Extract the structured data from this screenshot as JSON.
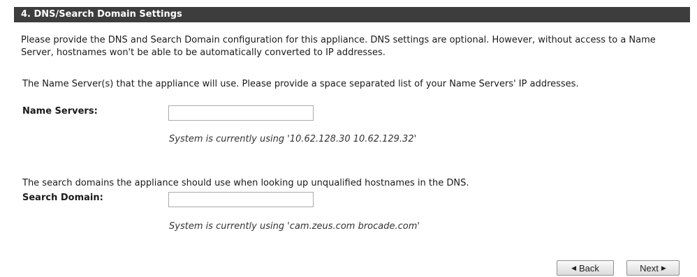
{
  "section": {
    "title": "4. DNS/Search Domain Settings",
    "intro": "Please provide the DNS and Search Domain configuration for this appliance. DNS settings are optional. However, without access to a Name Server, hostnames won't be able to be automatically converted to IP addresses."
  },
  "name_servers": {
    "description": "The Name Server(s) that the appliance will use. Please provide a space separated list of your Name Servers' IP addresses.",
    "label": "Name Servers:",
    "value": "",
    "current": "System is currently using '10.62.128.30 10.62.129.32'"
  },
  "search_domain": {
    "description": "The search domains the appliance should use when looking up unqualified hostnames in the DNS.",
    "label": "Search Domain:",
    "value": "",
    "current": "System is currently using 'cam.zeus.com brocade.com'"
  },
  "buttons": {
    "back_label": "Back",
    "back_icon": "triangle-left-icon",
    "next_label": "Next",
    "next_icon": "triangle-right-icon"
  }
}
